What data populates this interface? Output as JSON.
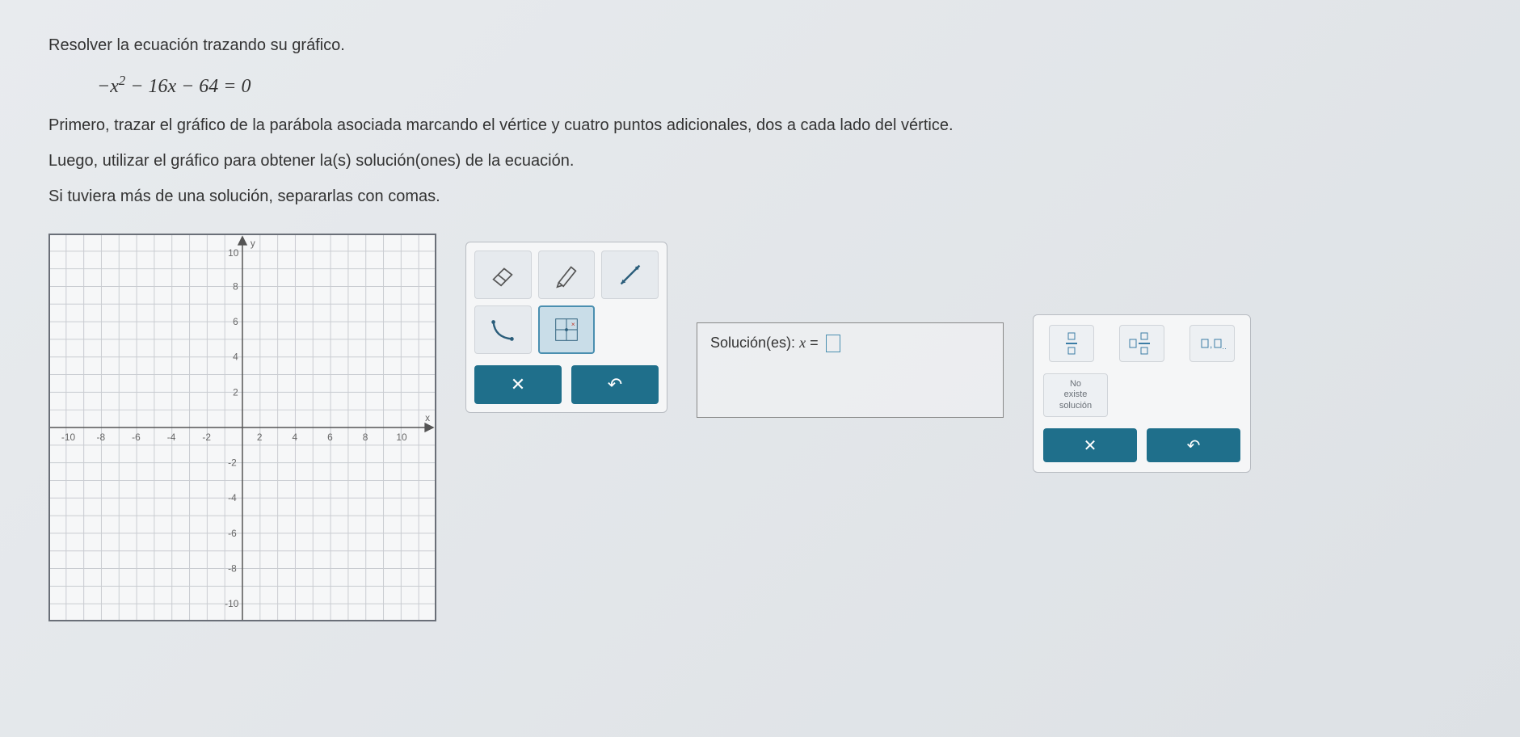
{
  "problem": {
    "intro": "Resolver la ecuación trazando su gráfico.",
    "equation_display": "−x² − 16x − 64 = 0",
    "step1": "Primero, trazar el gráfico de la parábola asociada marcando el vértice y cuatro puntos adicionales, dos a cada lado del vértice.",
    "step2": "Luego, utilizar el gráfico para obtener la(s) solución(ones) de la ecuación.",
    "step3": "Si tuviera más de una solución, separarlas con comas."
  },
  "graph": {
    "x_axis_label": "x",
    "y_axis_label": "y",
    "x_ticks": [
      "-10",
      "-8",
      "-6",
      "-4",
      "-2",
      "2",
      "4",
      "6",
      "8",
      "10"
    ],
    "y_ticks": [
      "-10",
      "-8",
      "-6",
      "-4",
      "-2",
      "2",
      "4",
      "6",
      "8",
      "10"
    ],
    "xlim": [
      -11,
      11
    ],
    "ylim": [
      -11,
      11
    ]
  },
  "tools": {
    "names": [
      "eraser",
      "pencil",
      "line",
      "curve",
      "grid-point"
    ]
  },
  "solution": {
    "label_prefix": "Solución(es): ",
    "var": "x",
    "equals": " = "
  },
  "keypad": {
    "no_solution_line1": "No",
    "no_solution_line2": "existe",
    "no_solution_line3": "solución"
  },
  "actions": {
    "clear": "×",
    "reset": "↺"
  },
  "chart_data": {
    "type": "scatter",
    "title": "",
    "xlabel": "x",
    "ylabel": "y",
    "xlim": [
      -11,
      11
    ],
    "ylim": [
      -11,
      11
    ],
    "series": [
      {
        "name": "plotted-points",
        "x": [],
        "y": []
      }
    ],
    "grid": true
  }
}
